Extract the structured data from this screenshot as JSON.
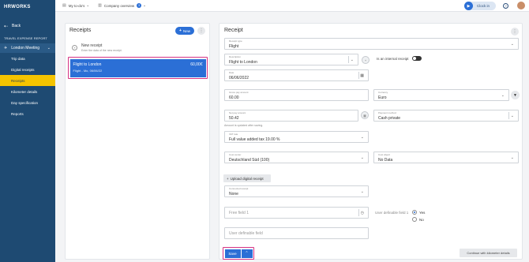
{
  "app": {
    "logo": "HRWORKS"
  },
  "sidebar": {
    "back_label": "Back",
    "section_title": "TRAVEL EXPENSE REPORT",
    "meeting_label": "London Meeting",
    "items": [
      {
        "label": "Trip data"
      },
      {
        "label": "Digital receipts"
      },
      {
        "label": "Receipts"
      },
      {
        "label": "Kilometer details"
      },
      {
        "label": "Day specification"
      },
      {
        "label": "Reports"
      }
    ]
  },
  "topbar": {
    "todos_label": "My to-do's",
    "company_label": "Company overview",
    "company_badge": "3",
    "clock_label": "Clock in"
  },
  "receipts_panel": {
    "title": "Receipts",
    "new_button": "New",
    "new_receipt_title": "New receipt",
    "new_receipt_hint": "Enter the data of the new receipt.",
    "selected_receipt": {
      "name": "Flight to London",
      "amount": "60,00€",
      "subtitle": "Flight - Mo, 06/06/22"
    }
  },
  "receipt_form": {
    "title": "Receipt",
    "receipt_type": {
      "label": "Receipt type",
      "value": "Flight"
    },
    "description": {
      "label": "Description",
      "value": "Flight to London"
    },
    "internal_receipt_label": "Is an internal receipt",
    "date": {
      "label": "Date",
      "value": "06/06/2022"
    },
    "gross_pay_amount": {
      "label": "Gross pay amount",
      "value": "60.00"
    },
    "currency": {
      "label": "Currency",
      "value": "Euro"
    },
    "net_pay_amount": {
      "label": "Net pay amount",
      "value": "50.42"
    },
    "payment_method": {
      "label": "Payment method",
      "value": "Cash private"
    },
    "amount_hint": "Amount is updated after saving.",
    "vat_rate": {
      "label": "VAT rate",
      "value": "Full value added tax 19.00 %"
    },
    "cost_center": {
      "label": "Cost center",
      "value": "Deutschland Süd (100)"
    },
    "cost_object": {
      "label": "Cost object",
      "value": "No Data"
    },
    "upload_button": "Upload digital receipt",
    "connected_receipt": {
      "label": "Connected receipt",
      "value": "None"
    },
    "free_field_1": {
      "placeholder": "Free field 1"
    },
    "user_field_1_label": "User definable field 1",
    "radio_options": [
      {
        "label": "Yes",
        "checked": true
      },
      {
        "label": "No",
        "checked": false
      }
    ],
    "user_field_placeholder": "User definable field",
    "save_button": "Save",
    "continue_button": "Continue with kilometer details"
  },
  "colors": {
    "sidebar": "#1e4a72",
    "accent": "#2b6fd6",
    "active_nav": "#f5c400",
    "highlight": "#d63384"
  },
  "icons": [
    "back-arrow-icon",
    "plane-icon",
    "chevron-down-icon",
    "clipboard-icon",
    "building-icon",
    "play-icon",
    "help-icon",
    "plus-icon",
    "kebab-icon",
    "plus-circle-icon",
    "calendar-icon",
    "filter-icon",
    "upload-icon",
    "clock-icon",
    "chevron-up-icon",
    "avatar"
  ]
}
